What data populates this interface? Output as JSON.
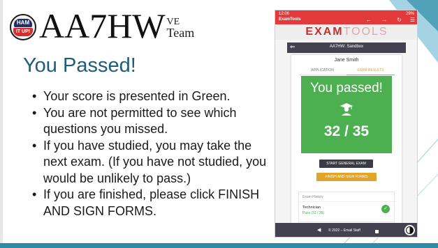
{
  "logo": {
    "badge_top": "HAM",
    "badge_bottom": "IT UP!",
    "callsign": "AA7HW",
    "ve": "VE",
    "team": "Team"
  },
  "slide": {
    "title": "You Passed!",
    "bullets": [
      "Your score is presented in Green.",
      "You are not permitted to see which questions you missed.",
      "If you have studied, you may take the next exam. (If you have not studied, you would be unlikely to pass.)",
      "If you are finished, please click FINISH AND SIGN FORMS."
    ]
  },
  "tablet": {
    "status": {
      "time": "12:06",
      "app": "ExamTools",
      "battery": "29%",
      "nav": "←  →  ↻"
    },
    "banner_bold": "EXAM",
    "banner_light": "TOOLS",
    "appbar_title": "AA7HW: Sandbox",
    "person": "Jane Smith",
    "tabs": [
      "APPLICATION",
      "EXAM RESULTS"
    ],
    "result": {
      "message": "You passed!",
      "score": "32 / 35"
    },
    "buttons": {
      "general": "START GENERAL EXAM",
      "finish": "FINISH AND SIGN FORMS"
    },
    "history": {
      "label": "Exam History",
      "exam": "Technician",
      "status": "Pass (32 / 35)"
    },
    "footer": "© 2022 – Email Staff"
  },
  "colors": {
    "title": "#1d5d7a",
    "pass_green": "#4caf50",
    "accent_orange": "#e0a42b",
    "status_red": "#e23a3a",
    "appbar_dark": "#444250"
  }
}
